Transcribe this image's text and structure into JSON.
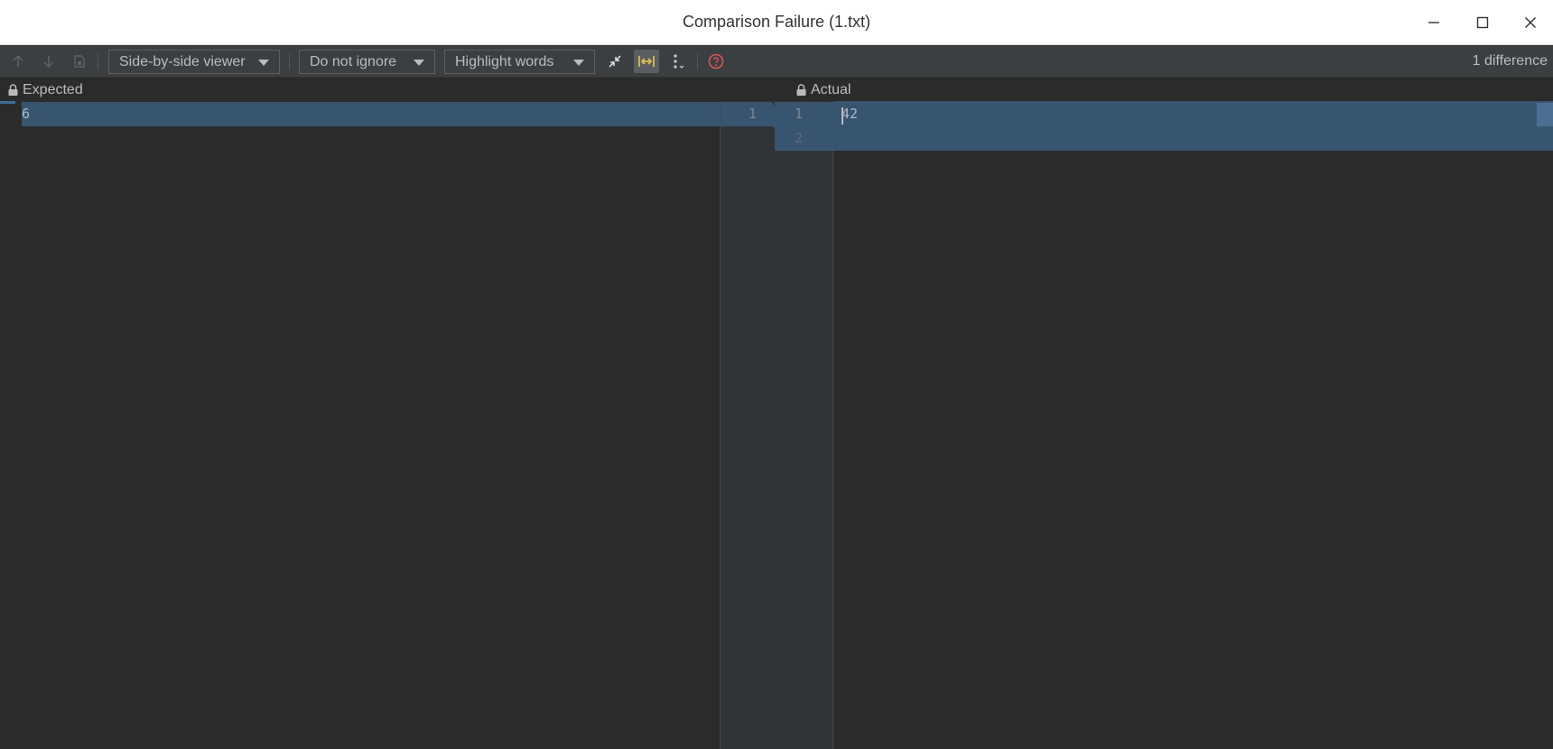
{
  "window": {
    "title": "Comparison Failure (1.txt)",
    "controls": [
      "minimize-icon",
      "maximize-icon",
      "close-icon"
    ]
  },
  "toolbar": {
    "prev_diff_icon": "arrow-up-icon",
    "next_diff_icon": "arrow-down-icon",
    "edit_source_icon": "edit-source-icon",
    "viewer_select": "Side-by-side viewer",
    "whitespace_select": "Do not ignore",
    "highlight_select": "Highlight words",
    "collapse_icon": "collapse-unchanged-icon",
    "sync_scroll_icon": "synchronize-scrolling-icon",
    "more_icon": "more-options-icon",
    "help_icon": "help-icon",
    "difference_count": "1 difference",
    "accent_color": "#e4c855",
    "help_color": "#e05555"
  },
  "left_pane": {
    "header": "Expected",
    "lines": [
      "6"
    ],
    "line_numbers": [
      "1"
    ]
  },
  "right_pane": {
    "header": "Actual",
    "lines": [
      "42",
      ""
    ],
    "line_numbers": [
      "1",
      "2"
    ]
  },
  "colors": {
    "changed_background": "#385570",
    "editor_background": "#2b2b2b",
    "gutter_background": "#313335"
  }
}
